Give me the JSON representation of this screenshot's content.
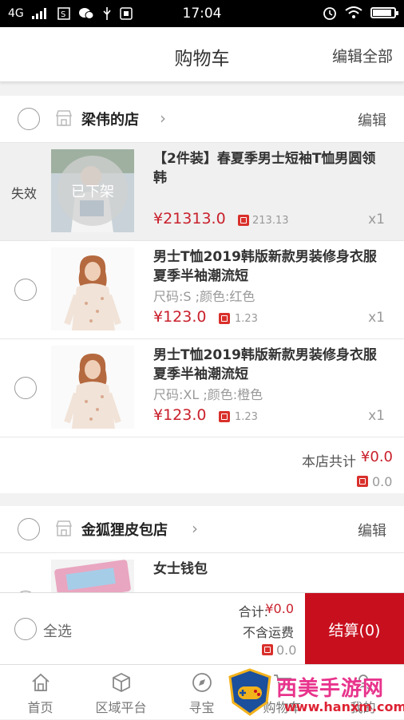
{
  "status_bar": {
    "network": "4G",
    "time": "17:04",
    "battery_level": 0.9
  },
  "header": {
    "title": "购物车",
    "edit_all": "编辑全部"
  },
  "shops": [
    {
      "name": "梁伟的店",
      "edit": "编辑",
      "items": [
        {
          "status": "失效",
          "overlay": "已下架",
          "title": "【2件装】春夏季男士短袖T恤男圆领韩",
          "spec": "",
          "price": "¥21313.0",
          "coin": "213.13",
          "qty": "x1"
        },
        {
          "title": "男士T恤2019韩版新款男装修身衣服夏季半袖潮流短",
          "spec": "尺码:S ;颜色:红色",
          "price": "¥123.0",
          "coin": "1.23",
          "qty": "x1"
        },
        {
          "title": "男士T恤2019韩版新款男装修身衣服夏季半袖潮流短",
          "spec": "尺码:XL ;颜色:橙色",
          "price": "¥123.0",
          "coin": "1.23",
          "qty": "x1"
        }
      ],
      "subtotal_label": "本店共计",
      "subtotal_amount": "¥0.0",
      "subtotal_coin": "0.0"
    },
    {
      "name": "金狐狸皮包店",
      "edit": "编辑",
      "items": [
        {
          "title": "女士钱包"
        }
      ]
    }
  ],
  "footer": {
    "select_all": "全选",
    "total_label": "合计:",
    "total_amount": "¥0.0",
    "shipping_note": "不含运费",
    "coin": "0.0",
    "checkout": "结算(0)"
  },
  "tabs": [
    {
      "label": "首页",
      "icon": "home-icon"
    },
    {
      "label": "区域平台",
      "icon": "cube-icon"
    },
    {
      "label": "寻宝",
      "icon": "compass-icon"
    },
    {
      "label": "购物车",
      "icon": "cart-icon"
    },
    {
      "label": "我的",
      "icon": "user-icon"
    }
  ],
  "watermark": {
    "text": "西美手游网",
    "url": "www.hanxm.com"
  },
  "colors": {
    "accent": "#c80f1e",
    "price": "#c9202c",
    "coin": "#d9302b"
  }
}
